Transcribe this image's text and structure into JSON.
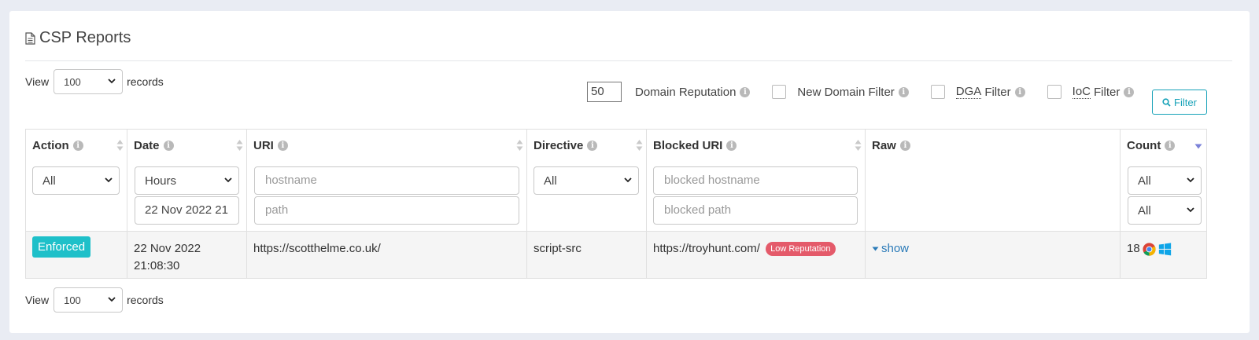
{
  "page": {
    "title": "CSP Reports"
  },
  "view": {
    "prefix": "View",
    "suffix": "records",
    "value": "100"
  },
  "filters": {
    "reputation_value": "50",
    "domain_reputation_label": "Domain Reputation",
    "new_domain_label": "New Domain Filter",
    "dga_abbr": "DGA",
    "dga_label": "Filter",
    "ioc_abbr": "IoC",
    "ioc_label": "Filter",
    "filter_button": "Filter",
    "info_glyph": "i"
  },
  "table": {
    "headers": {
      "action": "Action",
      "date": "Date",
      "uri": "URI",
      "directive": "Directive",
      "blocked_uri": "Blocked URI",
      "raw": "Raw",
      "count": "Count"
    },
    "header_filters": {
      "action_select": "All",
      "date_select": "Hours",
      "date_value": "22 Nov 2022 21",
      "uri_hostname_placeholder": "hostname",
      "uri_path_placeholder": "path",
      "directive_select": "All",
      "blocked_hostname_placeholder": "blocked hostname",
      "blocked_path_placeholder": "blocked path",
      "count_select_1": "All",
      "count_select_2": "All"
    },
    "rows": [
      {
        "action": "Enforced",
        "date_line1": "22 Nov 2022",
        "date_line2": "21:08:30",
        "uri": "https://scotthelme.co.uk/",
        "directive": "script-src",
        "blocked_uri": "https://troyhunt.com/",
        "reputation_badge": "Low Reputation",
        "raw": "show",
        "count": "18",
        "browser_icon": "chrome-icon",
        "os_icon": "windows-icon"
      }
    ]
  },
  "colors": {
    "accent": "#17a2b8",
    "enforced": "#1ec0c9",
    "low_reputation": "#e45a6a",
    "link": "#2a7ab8",
    "sort_active": "#7b82d8"
  }
}
